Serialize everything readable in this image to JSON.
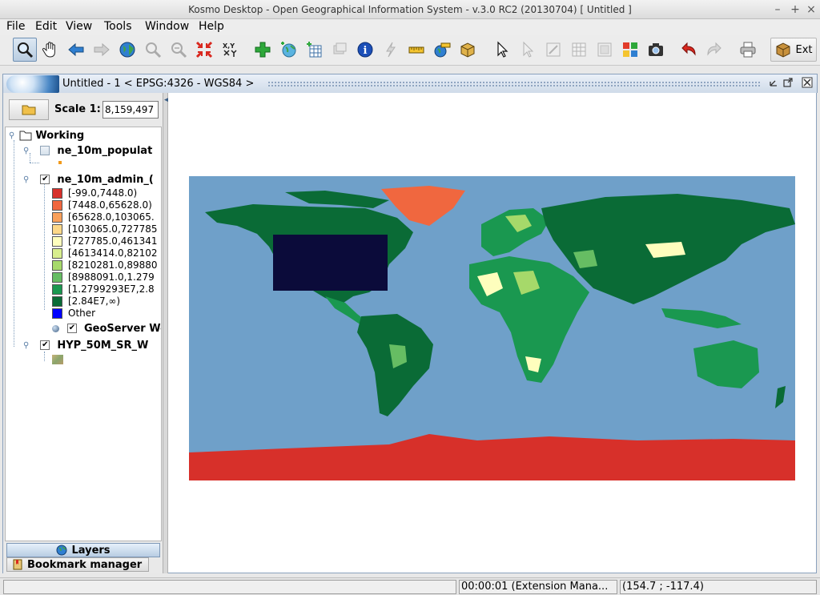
{
  "window": {
    "title": "Kosmo Desktop - Open Geographical Information System - v.3.0 RC2 (20130704)  [ Untitled ]",
    "controls": [
      "–",
      "+",
      "×"
    ]
  },
  "menu": [
    "File",
    "Edit",
    "View",
    "Tools",
    "Window",
    "Help"
  ],
  "toolbar": {
    "ext_label": "Ext"
  },
  "document": {
    "title": "Untitled - 1 < EPSG:4326 - WGS84 >"
  },
  "scale": {
    "label": "Scale 1:",
    "value": "8,159,497"
  },
  "layer_tree": {
    "category": "Working",
    "layers": [
      {
        "name": "ne_10m_populat",
        "checked": false
      },
      {
        "name": "ne_10m_admin_(",
        "checked": true
      },
      {
        "name": "GeoServer We",
        "checked": true
      },
      {
        "name": "HYP_50M_SR_W",
        "checked": true
      }
    ],
    "legend": [
      {
        "label": "[-99.0,7448.0)",
        "color": "#d7302a"
      },
      {
        "label": "[7448.0,65628.0)",
        "color": "#f0673f"
      },
      {
        "label": "[65628.0,103065.",
        "color": "#f9a05a"
      },
      {
        "label": "[103065.0,727785",
        "color": "#fdd888"
      },
      {
        "label": "[727785.0,461341",
        "color": "#fefebd"
      },
      {
        "label": "[4613414.0,82102",
        "color": "#d8ee8e"
      },
      {
        "label": "[8210281.0,89880",
        "color": "#a6d96a"
      },
      {
        "label": "[8988091.0,1.279",
        "color": "#66bd63"
      },
      {
        "label": "[1.2799293E7,2.8",
        "color": "#1a9850"
      },
      {
        "label": "[2.84E7,∞)",
        "color": "#0a6b36"
      },
      {
        "label": "Other",
        "color": "#0000ff"
      }
    ]
  },
  "tabs": {
    "layers": "Layers",
    "bookmarks": "Bookmark manager"
  },
  "status": {
    "left": "",
    "task": "00:00:01 (Extension Mana...",
    "coords": "(154.7 ; -117.4)"
  }
}
